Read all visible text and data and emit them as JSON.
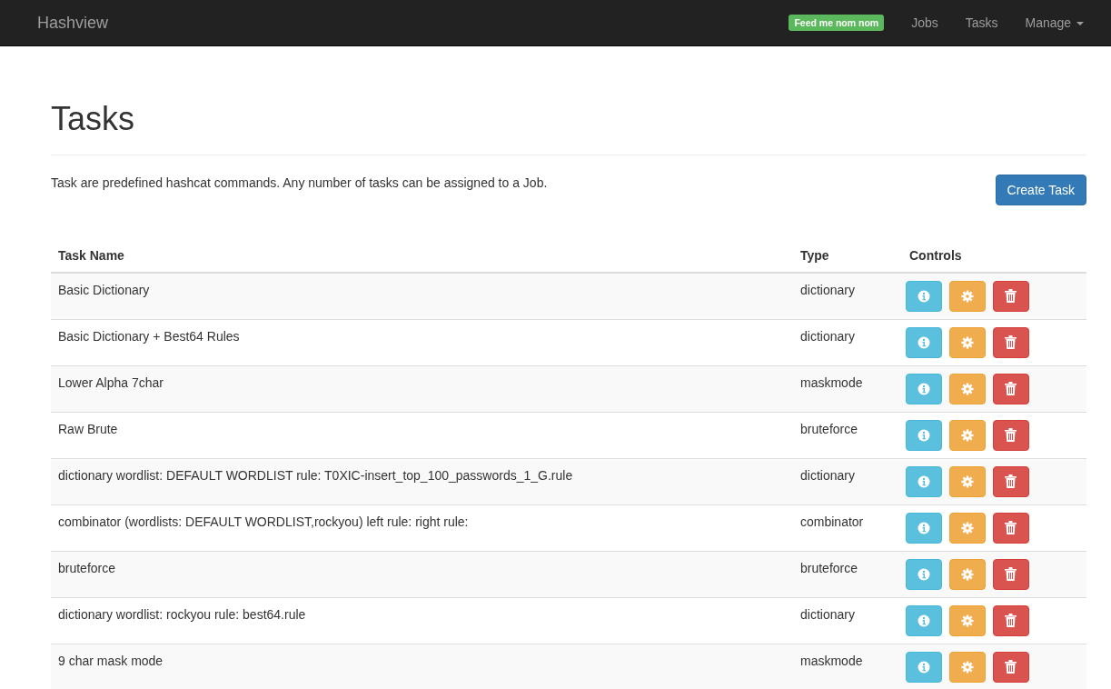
{
  "navbar": {
    "brand": "Hashview",
    "badge": "Feed me nom nom",
    "links": [
      {
        "label": "Jobs",
        "kind": "link"
      },
      {
        "label": "Tasks",
        "kind": "link"
      },
      {
        "label": "Manage",
        "kind": "dropdown"
      }
    ]
  },
  "page": {
    "title": "Tasks",
    "description": "Task are predefined hashcat commands. Any number of tasks can be assigned to a Job.",
    "create_button": "Create Task"
  },
  "table": {
    "columns": [
      "Task Name",
      "Type",
      "Controls"
    ],
    "rows": [
      {
        "name": "Basic Dictionary",
        "type": "dictionary"
      },
      {
        "name": "Basic Dictionary + Best64 Rules",
        "type": "dictionary"
      },
      {
        "name": "Lower Alpha 7char",
        "type": "maskmode"
      },
      {
        "name": "Raw Brute",
        "type": "bruteforce"
      },
      {
        "name": "dictionary wordlist: DEFAULT WORDLIST rule: T0XIC-insert_top_100_passwords_1_G.rule",
        "type": "dictionary"
      },
      {
        "name": "combinator (wordlists: DEFAULT WORDLIST,rockyou) left rule: right rule:",
        "type": "combinator"
      },
      {
        "name": "bruteforce",
        "type": "bruteforce"
      },
      {
        "name": "dictionary wordlist: rockyou rule: best64.rule",
        "type": "dictionary"
      },
      {
        "name": "9 char mask mode",
        "type": "maskmode"
      }
    ]
  }
}
